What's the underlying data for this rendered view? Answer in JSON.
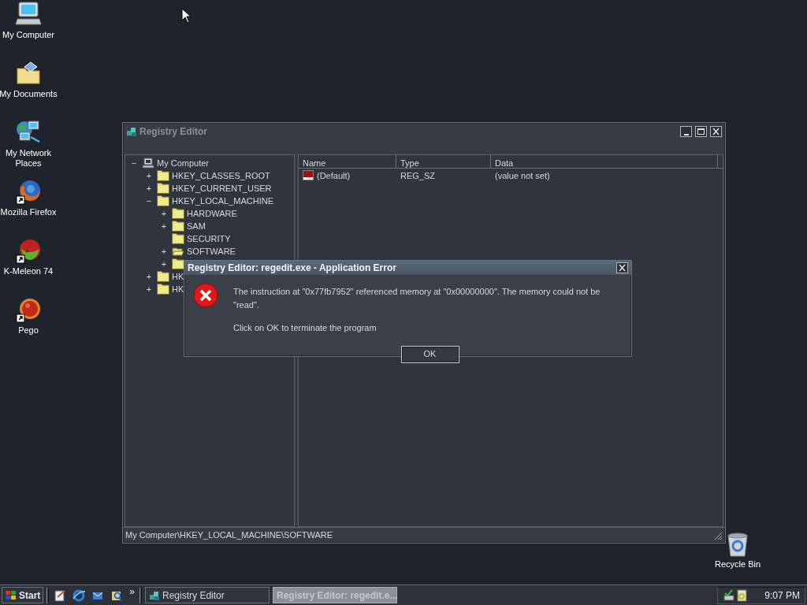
{
  "desktop_icons": [
    {
      "label": "My Computer",
      "kind": "computer",
      "shortcut": false
    },
    {
      "label": "My Documents",
      "kind": "documents",
      "shortcut": false
    },
    {
      "label": "My Network Places",
      "kind": "network",
      "shortcut": false
    },
    {
      "label": "Mozilla Firefox",
      "kind": "firefox",
      "shortcut": true
    },
    {
      "label": "K-Meleon 74",
      "kind": "kmeleon",
      "shortcut": true
    },
    {
      "label": "Pego",
      "kind": "pego",
      "shortcut": true
    }
  ],
  "recycle_bin": {
    "label": "Recycle Bin"
  },
  "registry_window": {
    "title": "Registry Editor",
    "tree": [
      {
        "label": "My Computer",
        "expander": "−",
        "kind": "computer",
        "selected": false,
        "children": [
          {
            "label": "HKEY_CLASSES_ROOT",
            "expander": "+",
            "kind": "folder",
            "selected": false
          },
          {
            "label": "HKEY_CURRENT_USER",
            "expander": "+",
            "kind": "folder",
            "selected": false
          },
          {
            "label": "HKEY_LOCAL_MACHINE",
            "expander": "−",
            "kind": "folder",
            "selected": false,
            "children": [
              {
                "label": "HARDWARE",
                "expander": "+",
                "kind": "folder",
                "selected": false
              },
              {
                "label": "SAM",
                "expander": "+",
                "kind": "folder",
                "selected": false
              },
              {
                "label": "SECURITY",
                "kind": "folder",
                "selected": false
              },
              {
                "label": "SOFTWARE",
                "expander": "+",
                "kind": "folder",
                "selected": true
              },
              {
                "expander": "+",
                "kind": "folder",
                "selected": false
              }
            ]
          },
          {
            "label": "HK",
            "expander": "+",
            "kind": "folder",
            "selected": false
          },
          {
            "label": "HK",
            "expander": "+",
            "kind": "folder",
            "selected": false
          }
        ]
      }
    ],
    "list": {
      "columns": [
        "Name",
        "Type",
        "Data"
      ],
      "rows": [
        {
          "name": "(Default)",
          "type": "REG_SZ",
          "data": "(value not set)"
        }
      ]
    },
    "status_bar": "My Computer\\HKEY_LOCAL_MACHINE\\SOFTWARE"
  },
  "error_dialog": {
    "title": "Registry Editor: regedit.exe - Application Error",
    "message": "The instruction at \"0x77fb7952\" referenced memory at \"0x00000000\". The memory could not be \"read\".",
    "note": "Click on OK to terminate the program",
    "button": "OK"
  },
  "taskbar": {
    "start": "Start",
    "more": "»",
    "tasks": [
      {
        "label": "Registry Editor",
        "selected": false
      },
      {
        "label": "Registry Editor: regedit.e...",
        "selected": true
      }
    ],
    "clock": "9:07 PM"
  }
}
